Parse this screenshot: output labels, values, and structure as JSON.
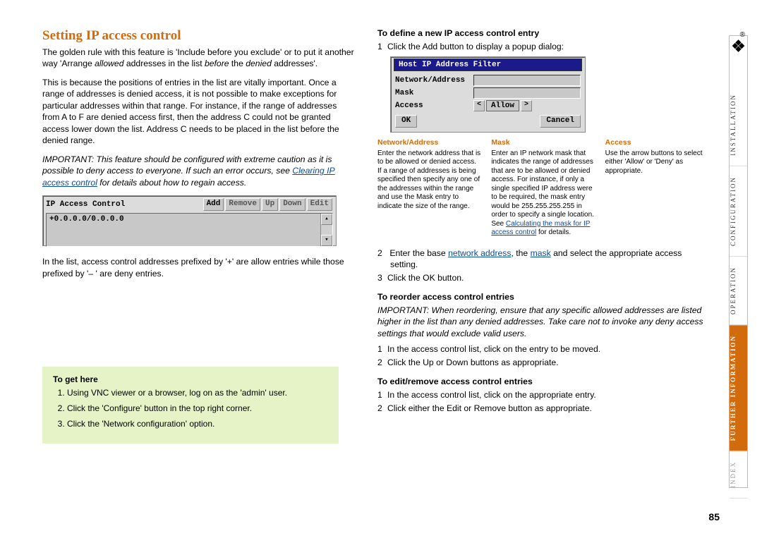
{
  "heading": "Setting IP access control",
  "para1_a": "The golden rule with this feature is 'Include before you exclude' or to put it another way 'Arrange ",
  "para1_b": "allowed",
  "para1_c": " addresses in the list ",
  "para1_d": "before",
  "para1_e": " the ",
  "para1_f": "denied",
  "para1_g": " addresses'.",
  "para2": "This is because the positions of entries in the list are vitally important. Once a range of addresses is denied access, it is not possible to make exceptions for particular addresses within that range. For instance, if the range of addresses from A to F are denied access first, then the address C could not be granted access lower down the list. Address C needs to be placed in the list before the denied range.",
  "para3_a": "IMPORTANT: This feature should be configured with extreme caution as it is possible to deny access to everyone. If such an error occurs, see ",
  "para3_link": "Clearing IP access control",
  "para3_b": " for details about how to regain access.",
  "ipbox": {
    "title": "IP Access Control",
    "btn_add": "Add",
    "btn_remove": "Remove",
    "btn_up": "Up",
    "btn_down": "Down",
    "btn_edit": "Edit",
    "entry": "+0.0.0.0/0.0.0.0"
  },
  "para4": "In the list, access control addresses prefixed by '+' are allow entries while those prefixed by '– ' are deny entries.",
  "togethere": {
    "hd": "To get here",
    "s1": "Using VNC viewer or a browser, log on as the 'admin' user.",
    "s2": "Click the 'Configure' button in the top right corner.",
    "s3": "Click the 'Network configuration' option."
  },
  "right": {
    "hd1": "To define a new IP access control entry",
    "s1_1": "Click the Add button to display a popup dialog:",
    "hostbox": {
      "title": "Host IP Address Filter",
      "l1": "Network/Address",
      "l2": "Mask",
      "l3": "Access",
      "allow": "Allow",
      "ok": "OK",
      "cancel": "Cancel"
    },
    "defs": {
      "na_hd": "Network/Address",
      "na_txt": "Enter the network address that is to be allowed or denied access. If a range of addresses is being specified then specify any one of the addresses within the range and use the Mask entry to indicate the size of the range.",
      "mask_hd": "Mask",
      "mask_txt": "Enter an IP network mask that indicates the range of addresses that are to be allowed or denied access. For instance, if only a single specified IP address were to be required, the mask entry would be 255.255.255.255 in order to specify a single location. See ",
      "mask_link": "Calculating the mask for IP access control",
      "mask_txt2": " for details.",
      "acc_hd": "Access",
      "acc_txt": "Use the arrow buttons to select either 'Allow' or 'Deny' as appropriate."
    },
    "s1_2a": "Enter the base ",
    "s1_2_link1": "network address",
    "s1_2b": ", the ",
    "s1_2_link2": "mask",
    "s1_2c": " and select the appropriate access setting.",
    "s1_3": "Click the OK button.",
    "hd2": "To reorder access control entries",
    "reorder_note": "IMPORTANT: When reordering, ensure that any specific allowed addresses are listed higher in the list than any denied addresses. Take care not to invoke any deny access settings that would exclude valid users.",
    "s2_1": "In the access control list, click on the entry to be moved.",
    "s2_2": "Click the Up or Down buttons as appropriate.",
    "hd3": "To edit/remove access control entries",
    "s3_1": "In the access control list, click on the appropriate entry.",
    "s3_2": "Click either the Edit or Remove button as appropriate."
  },
  "sidebar": {
    "items": [
      "INSTALLATION",
      "CONFIGURATION",
      "OPERATION",
      "FURTHER INFORMATION",
      "INDEX"
    ]
  },
  "page_number": "85"
}
